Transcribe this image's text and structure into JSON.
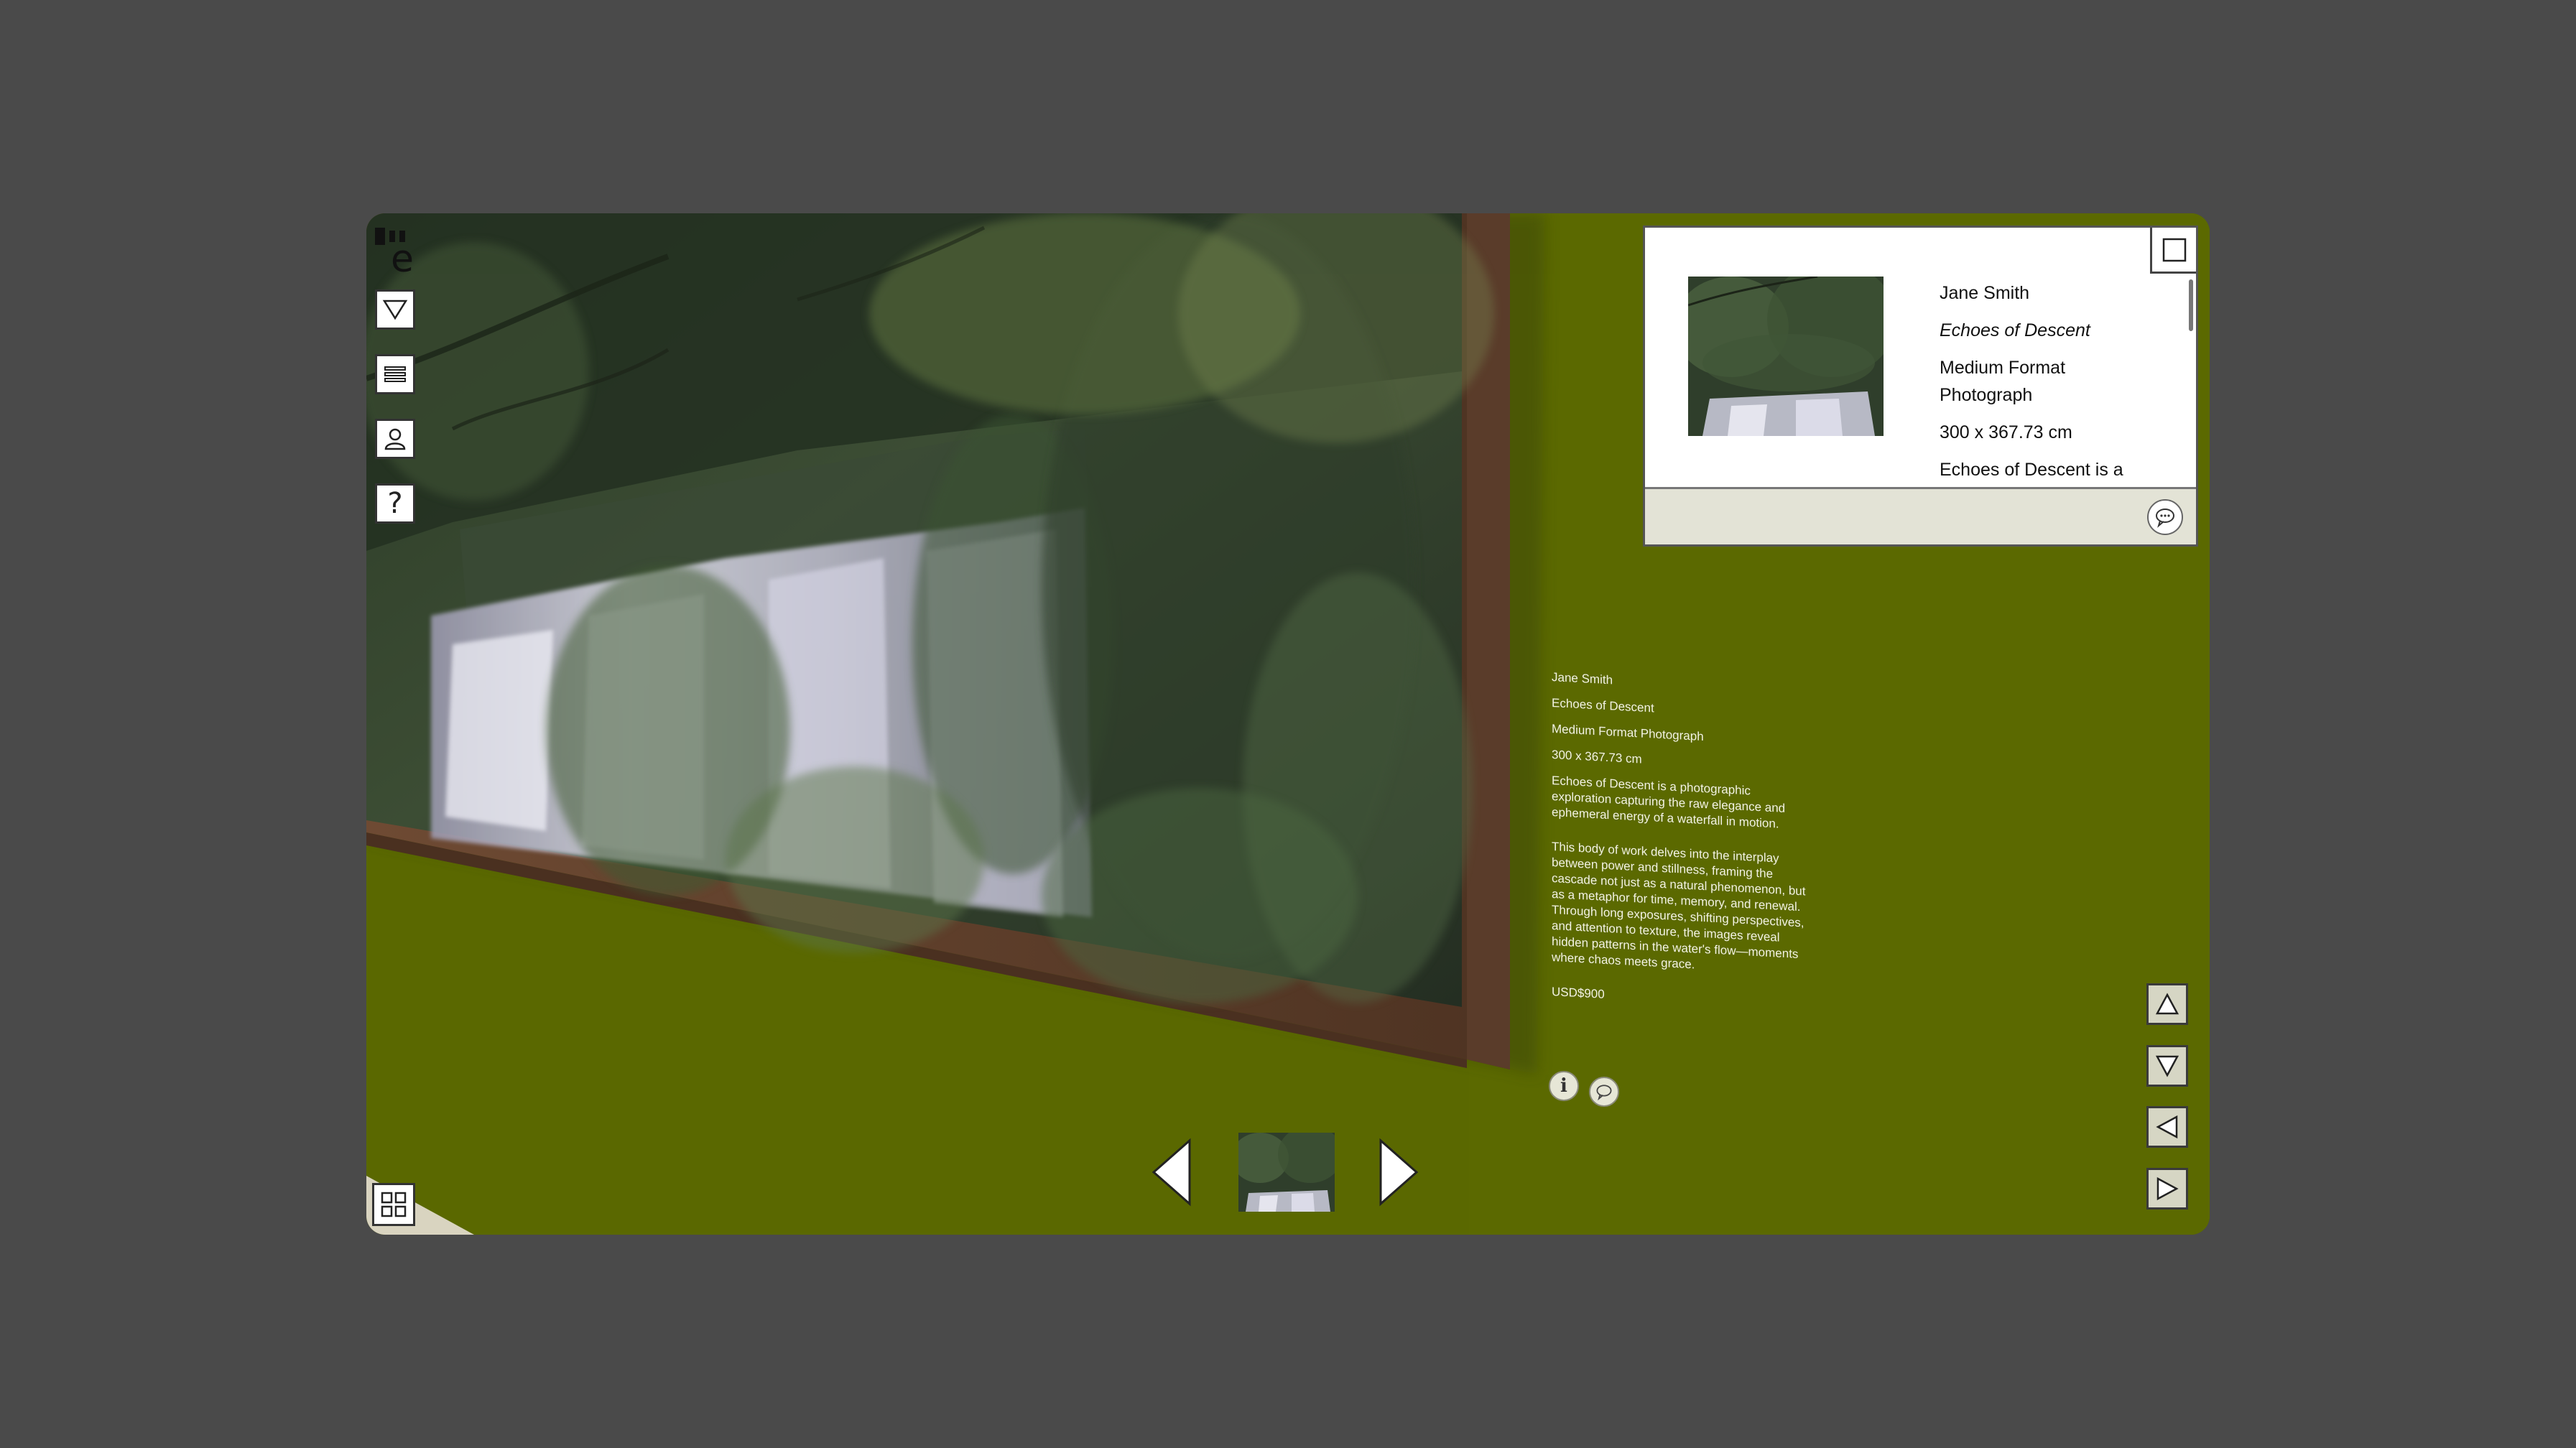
{
  "artwork": {
    "artist": "Jane Smith",
    "title": "Echoes of Descent",
    "medium": "Medium Format Photograph",
    "dimensions": "300 x 367.73 cm",
    "description_1": "Echoes of Descent is a photographic exploration capturing the raw elegance and ephemeral energy of a waterfall in motion.",
    "description_2": "This body of work delves into the interplay between power and stillness, framing the cascade not just as a natural phenomenon, but as a metaphor for time, memory, and renewal. Through long exposures, shifting perspectives, and attention to texture, the images reveal hidden patterns in the water's flow—moments where chaos meets grace.",
    "price": "USD$900"
  },
  "info_card": {
    "artist": "Jane Smith",
    "title": "Echoes of Descent",
    "medium": "Medium Format Photograph",
    "dimensions": "300 x 367.73 cm",
    "description_preview": "Echoes of Descent is a"
  },
  "left_toolbar": {
    "items": [
      {
        "name": "filter-icon"
      },
      {
        "name": "menu-icon"
      },
      {
        "name": "user-icon"
      },
      {
        "name": "help-icon",
        "glyph": "?"
      }
    ]
  },
  "label_icons": {
    "info_glyph": "i"
  },
  "colors": {
    "page_bg": "#4a4a4a",
    "wall": "#5a6800",
    "frame": "#5c3f2c",
    "nav_button": "#d6d6c4"
  }
}
